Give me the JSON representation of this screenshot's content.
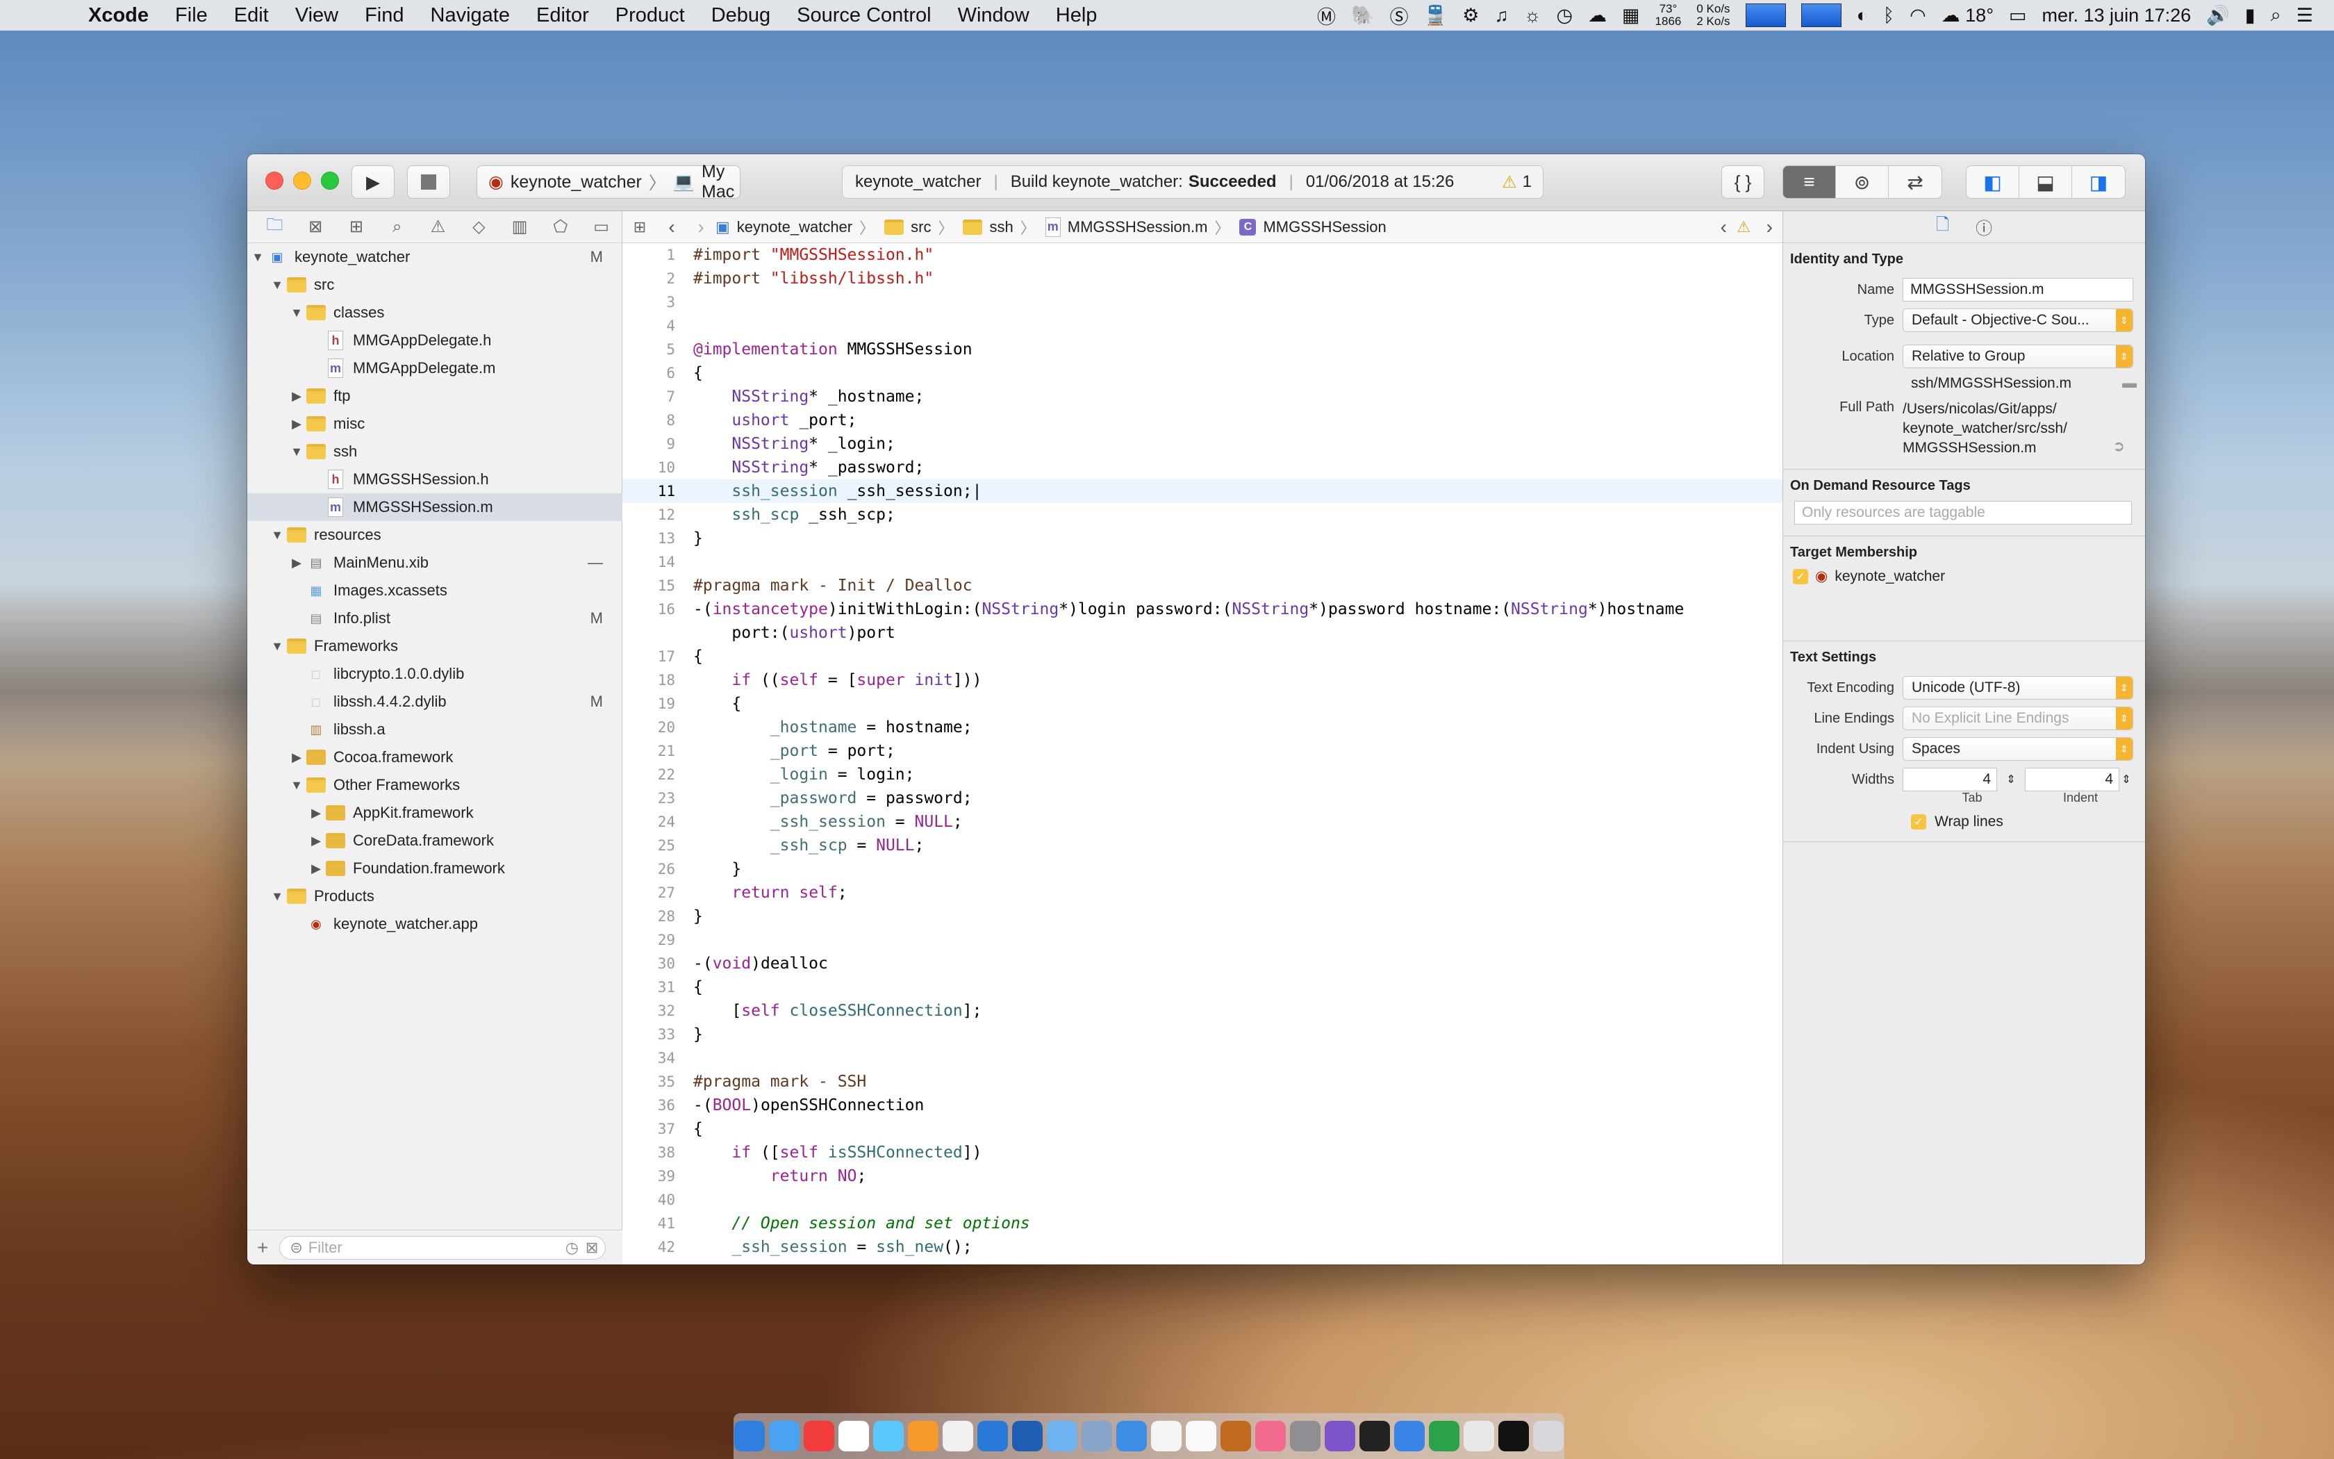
{
  "menubar": {
    "app": "Xcode",
    "items": [
      "File",
      "Edit",
      "View",
      "Find",
      "Navigate",
      "Editor",
      "Product",
      "Debug",
      "Source Control",
      "Window",
      "Help"
    ],
    "temp_top": "73°",
    "temp_bottom": "1866",
    "net_up": "0 Ko/s",
    "net_down": "2 Ko/s",
    "weather": "18°",
    "datetime": "mer. 13 juin 17:26"
  },
  "toolbar": {
    "scheme": "keynote_watcher",
    "destination": "My Mac",
    "activity_project": "keynote_watcher",
    "build_label": "Build keynote_watcher:",
    "build_result": "Succeeded",
    "build_date": "01/06/2018 at 15:26",
    "warnings": "1"
  },
  "navigator": {
    "filter_placeholder": "Filter",
    "items": [
      {
        "label": "keynote_watcher",
        "status": "M"
      },
      {
        "label": "src",
        "status": ""
      },
      {
        "label": "classes",
        "status": ""
      },
      {
        "label": "MMGAppDelegate.h",
        "status": ""
      },
      {
        "label": "MMGAppDelegate.m",
        "status": ""
      },
      {
        "label": "ftp",
        "status": ""
      },
      {
        "label": "misc",
        "status": ""
      },
      {
        "label": "ssh",
        "status": ""
      },
      {
        "label": "MMGSSHSession.h",
        "status": ""
      },
      {
        "label": "MMGSSHSession.m",
        "status": ""
      },
      {
        "label": "resources",
        "status": ""
      },
      {
        "label": "MainMenu.xib",
        "status": "—"
      },
      {
        "label": "Images.xcassets",
        "status": ""
      },
      {
        "label": "Info.plist",
        "status": "M"
      },
      {
        "label": "Frameworks",
        "status": ""
      },
      {
        "label": "libcrypto.1.0.0.dylib",
        "status": ""
      },
      {
        "label": "libssh.4.4.2.dylib",
        "status": "M"
      },
      {
        "label": "libssh.a",
        "status": ""
      },
      {
        "label": "Cocoa.framework",
        "status": ""
      },
      {
        "label": "Other Frameworks",
        "status": ""
      },
      {
        "label": "AppKit.framework",
        "status": ""
      },
      {
        "label": "CoreData.framework",
        "status": ""
      },
      {
        "label": "Foundation.framework",
        "status": ""
      },
      {
        "label": "Products",
        "status": ""
      },
      {
        "label": "keynote_watcher.app",
        "status": ""
      }
    ]
  },
  "jumpbar": [
    "keynote_watcher",
    "src",
    "ssh",
    "MMGSSHSession.m",
    "MMGSSHSession"
  ],
  "editor": {
    "current_line": "11"
  },
  "inspector": {
    "identity_title": "Identity and Type",
    "name_label": "Name",
    "name_value": "MMGSSHSession.m",
    "type_label": "Type",
    "type_value": "Default - Objective-C Sou...",
    "location_label": "Location",
    "location_value": "Relative to Group",
    "relative_path": "ssh/MMGSSHSession.m",
    "fullpath_label": "Full Path",
    "fullpath_1": "/Users/nicolas/Git/apps/",
    "fullpath_2": "keynote_watcher/src/ssh/",
    "fullpath_3": "MMGSSHSession.m",
    "odr_title": "On Demand Resource Tags",
    "odr_placeholder": "Only resources are taggable",
    "target_title": "Target Membership",
    "target_name": "keynote_watcher",
    "text_title": "Text Settings",
    "encoding_label": "Text Encoding",
    "encoding_value": "Unicode (UTF-8)",
    "endings_label": "Line Endings",
    "endings_value": "No Explicit Line Endings",
    "indent_label": "Indent Using",
    "indent_value": "Spaces",
    "widths_label": "Widths",
    "tab_value": "4",
    "indent_width_value": "4",
    "tab_label": "Tab",
    "indent_caption": "Indent",
    "wrap_label": "Wrap lines"
  }
}
